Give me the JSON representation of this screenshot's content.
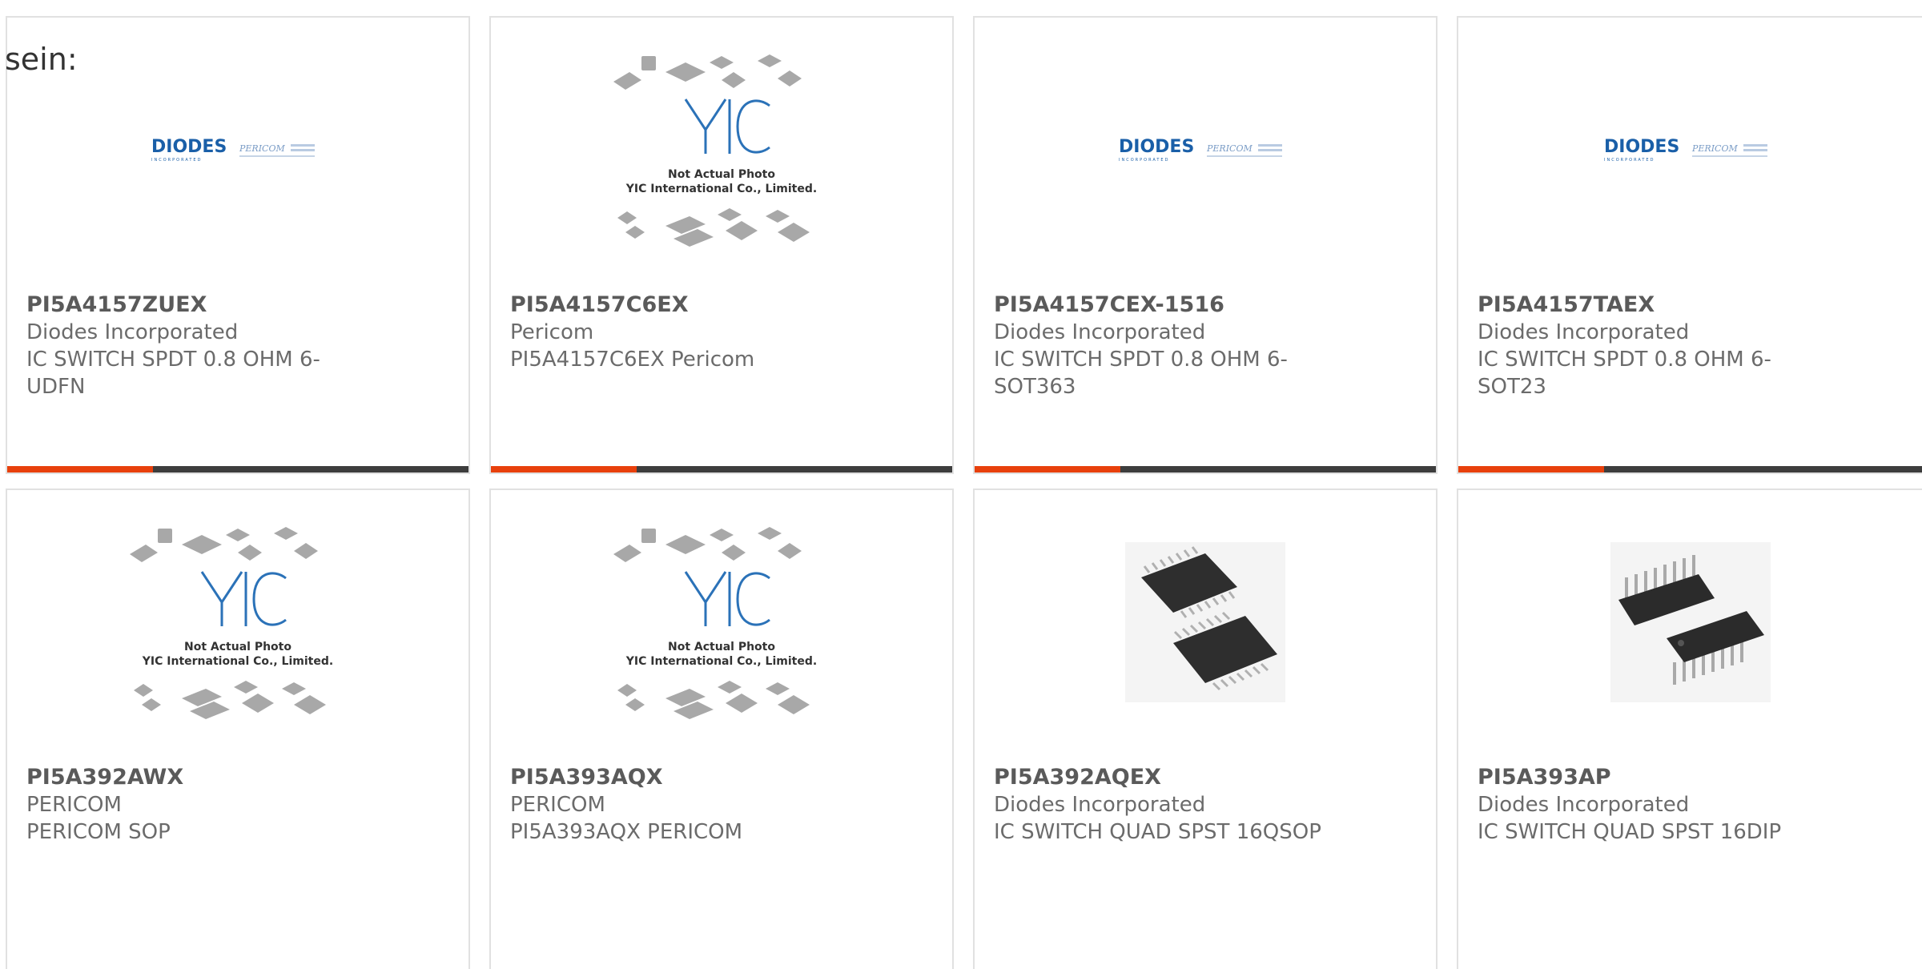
{
  "heading_fragment": "sein:",
  "colors": {
    "accent": "#e8400c",
    "bar": "#3d3d3d",
    "diodes_blue": "#1a5fa8",
    "yic_blue": "#2b72b8"
  },
  "products": [
    {
      "part": "PI5A4157ZUEX",
      "manufacturer": "Diodes Incorporated",
      "description": "IC SWITCH SPDT 0.8 OHM 6-UDFN",
      "image": "diodes-pericom-logo"
    },
    {
      "part": "PI5A4157C6EX",
      "manufacturer": "Pericom",
      "description": "PI5A4157C6EX Pericom",
      "image": "yic-placeholder"
    },
    {
      "part": "PI5A4157CEX-1516",
      "manufacturer": "Diodes Incorporated",
      "description": "IC SWITCH SPDT 0.8 OHM 6-SOT363",
      "image": "diodes-pericom-logo"
    },
    {
      "part": "PI5A4157TAEX",
      "manufacturer": "Diodes Incorporated",
      "description": "IC SWITCH SPDT 0.8 OHM 6-SOT23",
      "image": "diodes-pericom-logo"
    },
    {
      "part": "PI5A392AWX",
      "manufacturer": "PERICOM",
      "description": "PERICOM SOP",
      "image": "yic-placeholder"
    },
    {
      "part": "PI5A393AQX",
      "manufacturer": "PERICOM",
      "description": "PI5A393AQX PERICOM",
      "image": "yic-placeholder"
    },
    {
      "part": "PI5A392AQEX",
      "manufacturer": "Diodes Incorporated",
      "description": "IC SWITCH QUAD SPST 16QSOP",
      "image": "qsop-chip-photo"
    },
    {
      "part": "PI5A393AP",
      "manufacturer": "Diodes Incorporated",
      "description": "IC SWITCH QUAD SPST 16DIP",
      "image": "dip-chip-photo"
    }
  ],
  "logo": {
    "diodes_text": "DIODES",
    "diodes_sub": "INCORPORATED",
    "pericom_text": "PERICOM"
  },
  "placeholder": {
    "brand": "YIC",
    "line1": "Not Actual Photo",
    "line2": "YIC International Co., Limited."
  }
}
